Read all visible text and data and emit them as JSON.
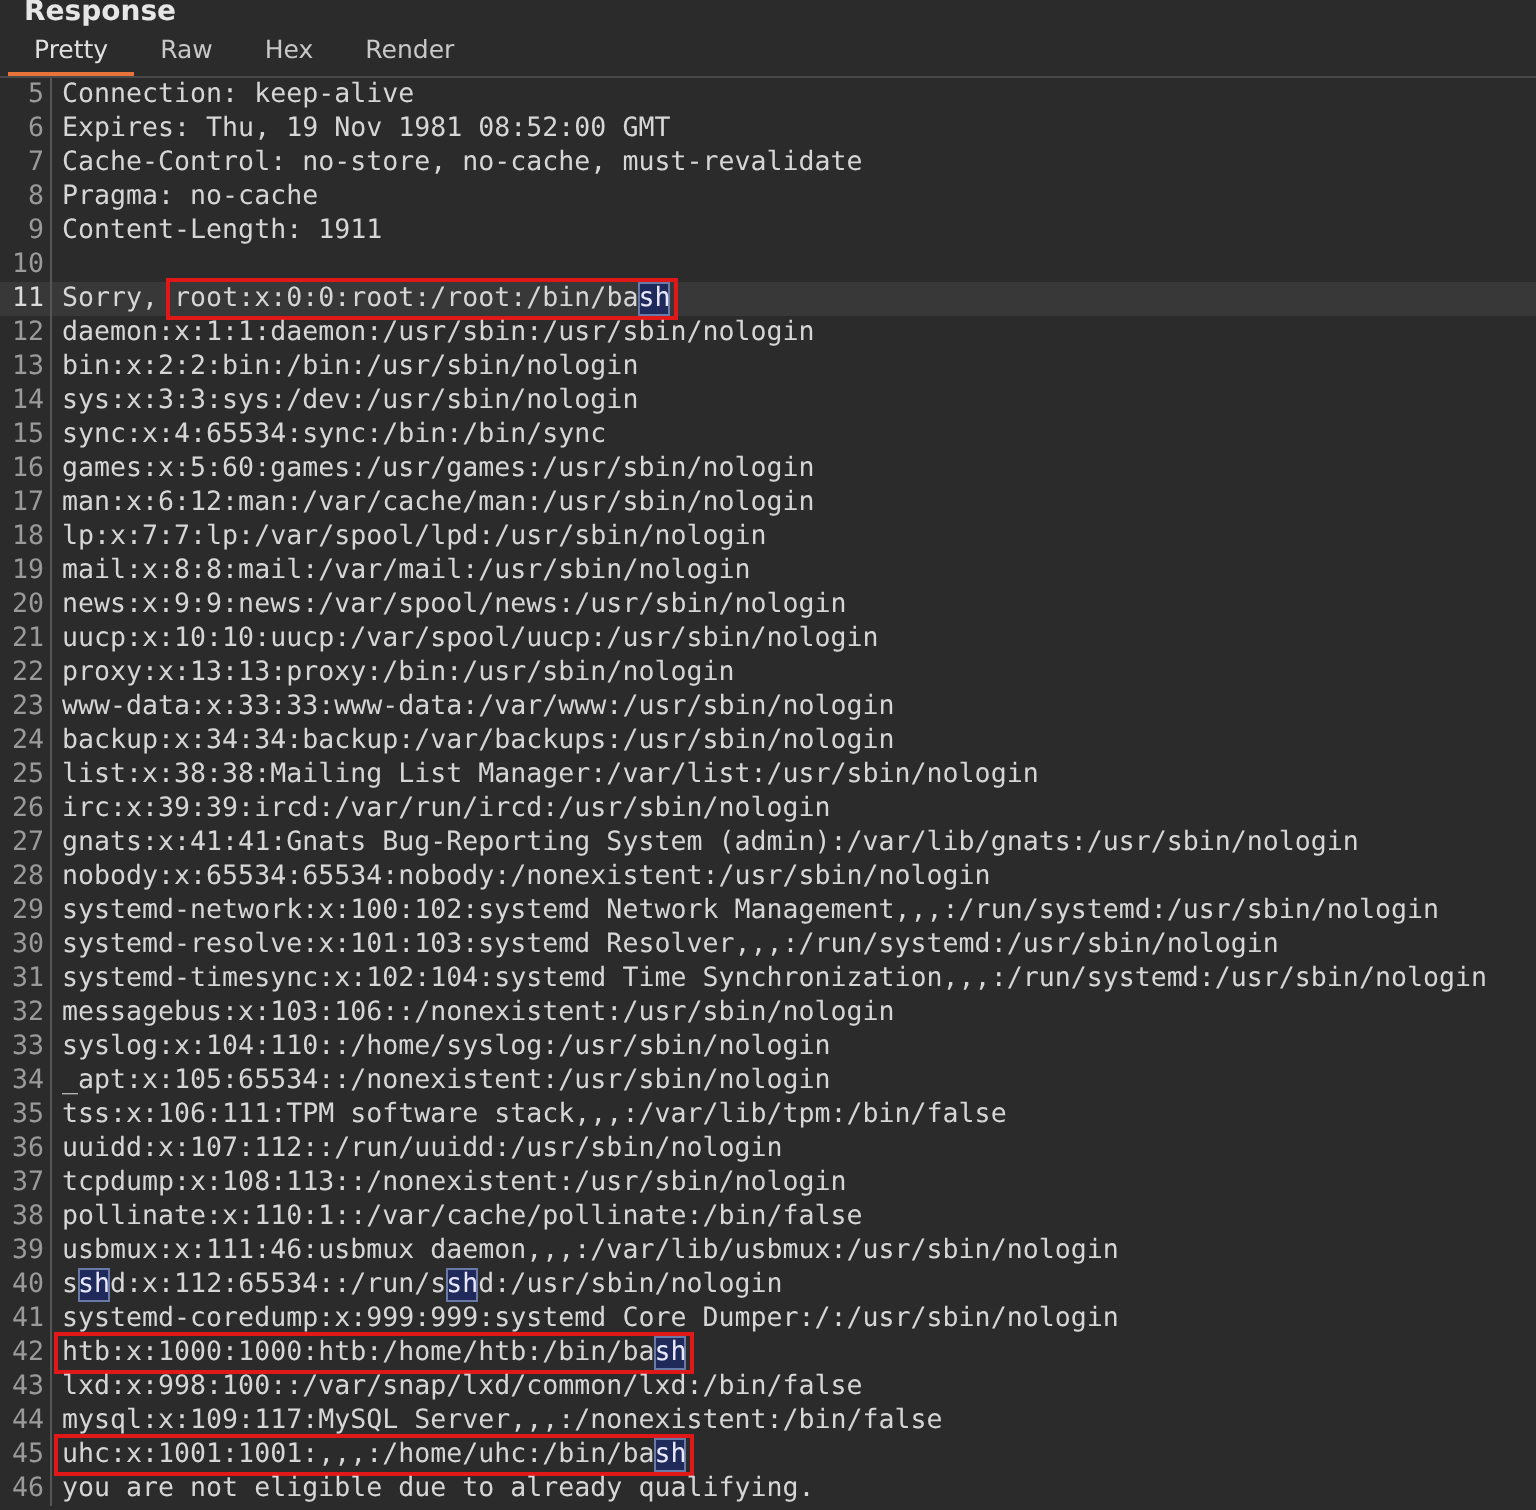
{
  "panel": {
    "title": "Response"
  },
  "tabs": [
    {
      "label": "Pretty",
      "selected": true
    },
    {
      "label": "Raw",
      "selected": false
    },
    {
      "label": "Hex",
      "selected": false
    },
    {
      "label": "Render",
      "selected": false
    }
  ],
  "lines": [
    {
      "number": "5",
      "current": false,
      "parts": [
        {
          "kind": "text",
          "text": "Connection: keep-alive"
        }
      ]
    },
    {
      "number": "6",
      "current": false,
      "parts": [
        {
          "kind": "text",
          "text": "Expires: Thu, 19 Nov 1981 08:52:00 GMT"
        }
      ]
    },
    {
      "number": "7",
      "current": false,
      "parts": [
        {
          "kind": "text",
          "text": "Cache-Control: no-store, no-cache, must-revalidate"
        }
      ]
    },
    {
      "number": "8",
      "current": false,
      "parts": [
        {
          "kind": "text",
          "text": "Pragma: no-cache"
        }
      ]
    },
    {
      "number": "9",
      "current": false,
      "parts": [
        {
          "kind": "text",
          "text": "Content-Length: 1911"
        }
      ]
    },
    {
      "number": "10",
      "current": false
    },
    {
      "number": "11",
      "current": true,
      "parts": [
        {
          "kind": "text",
          "text": "Sorry, "
        },
        {
          "kind": "box",
          "children": [
            {
              "kind": "text",
              "text": "root:x:0:0:root:/root:/bin/ba"
            },
            {
              "kind": "match",
              "text": "sh"
            }
          ]
        }
      ]
    },
    {
      "number": "12",
      "current": false,
      "parts": [
        {
          "kind": "text",
          "text": "daemon:x:1:1:daemon:/usr/sbin:/usr/sbin/nologin"
        }
      ]
    },
    {
      "number": "13",
      "current": false,
      "parts": [
        {
          "kind": "text",
          "text": "bin:x:2:2:bin:/bin:/usr/sbin/nologin"
        }
      ]
    },
    {
      "number": "14",
      "current": false,
      "parts": [
        {
          "kind": "text",
          "text": "sys:x:3:3:sys:/dev:/usr/sbin/nologin"
        }
      ]
    },
    {
      "number": "15",
      "current": false,
      "parts": [
        {
          "kind": "text",
          "text": "sync:x:4:65534:sync:/bin:/bin/sync"
        }
      ]
    },
    {
      "number": "16",
      "current": false,
      "parts": [
        {
          "kind": "text",
          "text": "games:x:5:60:games:/usr/games:/usr/sbin/nologin"
        }
      ]
    },
    {
      "number": "17",
      "current": false,
      "parts": [
        {
          "kind": "text",
          "text": "man:x:6:12:man:/var/cache/man:/usr/sbin/nologin"
        }
      ]
    },
    {
      "number": "18",
      "current": false,
      "parts": [
        {
          "kind": "text",
          "text": "lp:x:7:7:lp:/var/spool/lpd:/usr/sbin/nologin"
        }
      ]
    },
    {
      "number": "19",
      "current": false,
      "parts": [
        {
          "kind": "text",
          "text": "mail:x:8:8:mail:/var/mail:/usr/sbin/nologin"
        }
      ]
    },
    {
      "number": "20",
      "current": false,
      "parts": [
        {
          "kind": "text",
          "text": "news:x:9:9:news:/var/spool/news:/usr/sbin/nologin"
        }
      ]
    },
    {
      "number": "21",
      "current": false,
      "parts": [
        {
          "kind": "text",
          "text": "uucp:x:10:10:uucp:/var/spool/uucp:/usr/sbin/nologin"
        }
      ]
    },
    {
      "number": "22",
      "current": false,
      "parts": [
        {
          "kind": "text",
          "text": "proxy:x:13:13:proxy:/bin:/usr/sbin/nologin"
        }
      ]
    },
    {
      "number": "23",
      "current": false,
      "parts": [
        {
          "kind": "text",
          "text": "www-data:x:33:33:www-data:/var/www:/usr/sbin/nologin"
        }
      ]
    },
    {
      "number": "24",
      "current": false,
      "parts": [
        {
          "kind": "text",
          "text": "backup:x:34:34:backup:/var/backups:/usr/sbin/nologin"
        }
      ]
    },
    {
      "number": "25",
      "current": false,
      "parts": [
        {
          "kind": "text",
          "text": "list:x:38:38:Mailing List Manager:/var/list:/usr/sbin/nologin"
        }
      ]
    },
    {
      "number": "26",
      "current": false,
      "parts": [
        {
          "kind": "text",
          "text": "irc:x:39:39:ircd:/var/run/ircd:/usr/sbin/nologin"
        }
      ]
    },
    {
      "number": "27",
      "current": false,
      "parts": [
        {
          "kind": "text",
          "text": "gnats:x:41:41:Gnats Bug-Reporting System (admin):/var/lib/gnats:/usr/sbin/nologin"
        }
      ]
    },
    {
      "number": "28",
      "current": false,
      "parts": [
        {
          "kind": "text",
          "text": "nobody:x:65534:65534:nobody:/nonexistent:/usr/sbin/nologin"
        }
      ]
    },
    {
      "number": "29",
      "current": false,
      "parts": [
        {
          "kind": "text",
          "text": "systemd-network:x:100:102:systemd Network Management,,,:/run/systemd:/usr/sbin/nologin"
        }
      ]
    },
    {
      "number": "30",
      "current": false,
      "parts": [
        {
          "kind": "text",
          "text": "systemd-resolve:x:101:103:systemd Resolver,,,:/run/systemd:/usr/sbin/nologin"
        }
      ]
    },
    {
      "number": "31",
      "current": false,
      "parts": [
        {
          "kind": "text",
          "text": "systemd-timesync:x:102:104:systemd Time Synchronization,,,:/run/systemd:/usr/sbin/nologin"
        }
      ]
    },
    {
      "number": "32",
      "current": false,
      "parts": [
        {
          "kind": "text",
          "text": "messagebus:x:103:106::/nonexistent:/usr/sbin/nologin"
        }
      ]
    },
    {
      "number": "33",
      "current": false,
      "parts": [
        {
          "kind": "text",
          "text": "syslog:x:104:110::/home/syslog:/usr/sbin/nologin"
        }
      ]
    },
    {
      "number": "34",
      "current": false,
      "parts": [
        {
          "kind": "text",
          "text": "_apt:x:105:65534::/nonexistent:/usr/sbin/nologin"
        }
      ]
    },
    {
      "number": "35",
      "current": false,
      "parts": [
        {
          "kind": "text",
          "text": "tss:x:106:111:TPM software stack,,,:/var/lib/tpm:/bin/false"
        }
      ]
    },
    {
      "number": "36",
      "current": false,
      "parts": [
        {
          "kind": "text",
          "text": "uuidd:x:107:112::/run/uuidd:/usr/sbin/nologin"
        }
      ]
    },
    {
      "number": "37",
      "current": false,
      "parts": [
        {
          "kind": "text",
          "text": "tcpdump:x:108:113::/nonexistent:/usr/sbin/nologin"
        }
      ]
    },
    {
      "number": "38",
      "current": false,
      "parts": [
        {
          "kind": "text",
          "text": "pollinate:x:110:1::/var/cache/pollinate:/bin/false"
        }
      ]
    },
    {
      "number": "39",
      "current": false,
      "parts": [
        {
          "kind": "text",
          "text": "usbmux:x:111:46:usbmux daemon,,,:/var/lib/usbmux:/usr/sbin/nologin"
        }
      ]
    },
    {
      "number": "40",
      "current": false,
      "parts": [
        {
          "kind": "text",
          "text": "s"
        },
        {
          "kind": "match",
          "text": "sh"
        },
        {
          "kind": "text",
          "text": "d:x:112:65534::/run/s"
        },
        {
          "kind": "match",
          "text": "sh"
        },
        {
          "kind": "text",
          "text": "d:/usr/sbin/nologin"
        }
      ]
    },
    {
      "number": "41",
      "current": false,
      "parts": [
        {
          "kind": "text",
          "text": "systemd-coredump:x:999:999:systemd Core Dumper:/:/usr/sbin/nologin"
        }
      ]
    },
    {
      "number": "42",
      "current": false,
      "parts": [
        {
          "kind": "box",
          "children": [
            {
              "kind": "text",
              "text": "htb:x:1000:1000:htb:/home/htb:/bin/ba"
            },
            {
              "kind": "match",
              "text": "sh"
            }
          ]
        }
      ]
    },
    {
      "number": "43",
      "current": false,
      "parts": [
        {
          "kind": "text",
          "text": "lxd:x:998:100::/var/snap/lxd/common/lxd:/bin/false"
        }
      ]
    },
    {
      "number": "44",
      "current": false,
      "parts": [
        {
          "kind": "text",
          "text": "mysql:x:109:117:MySQL Server,,,:/nonexistent:/bin/false"
        }
      ]
    },
    {
      "number": "45",
      "current": false,
      "parts": [
        {
          "kind": "box",
          "children": [
            {
              "kind": "text",
              "text": "uhc:x:1001:1001:,,,:/home/uhc:/bin/ba"
            },
            {
              "kind": "match",
              "text": "sh"
            }
          ]
        }
      ]
    },
    {
      "number": "46",
      "current": false,
      "parts": [
        {
          "kind": "text",
          "text": "you are not eligible due to already qualifying."
        }
      ]
    }
  ]
}
